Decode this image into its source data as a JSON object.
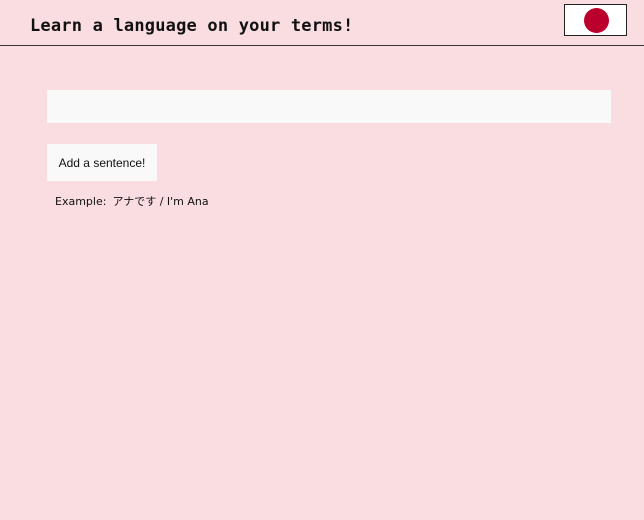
{
  "header": {
    "title": "Learn a language on your terms!",
    "language_flag": {
      "icon": "japan-flag-icon",
      "disc_color": "#bc002d"
    }
  },
  "composer": {
    "input_value": "",
    "input_placeholder": "",
    "add_button_label": "Add a sentence!"
  },
  "example": {
    "prefix": "Example:",
    "text": "アナです / I'm Ana"
  }
}
